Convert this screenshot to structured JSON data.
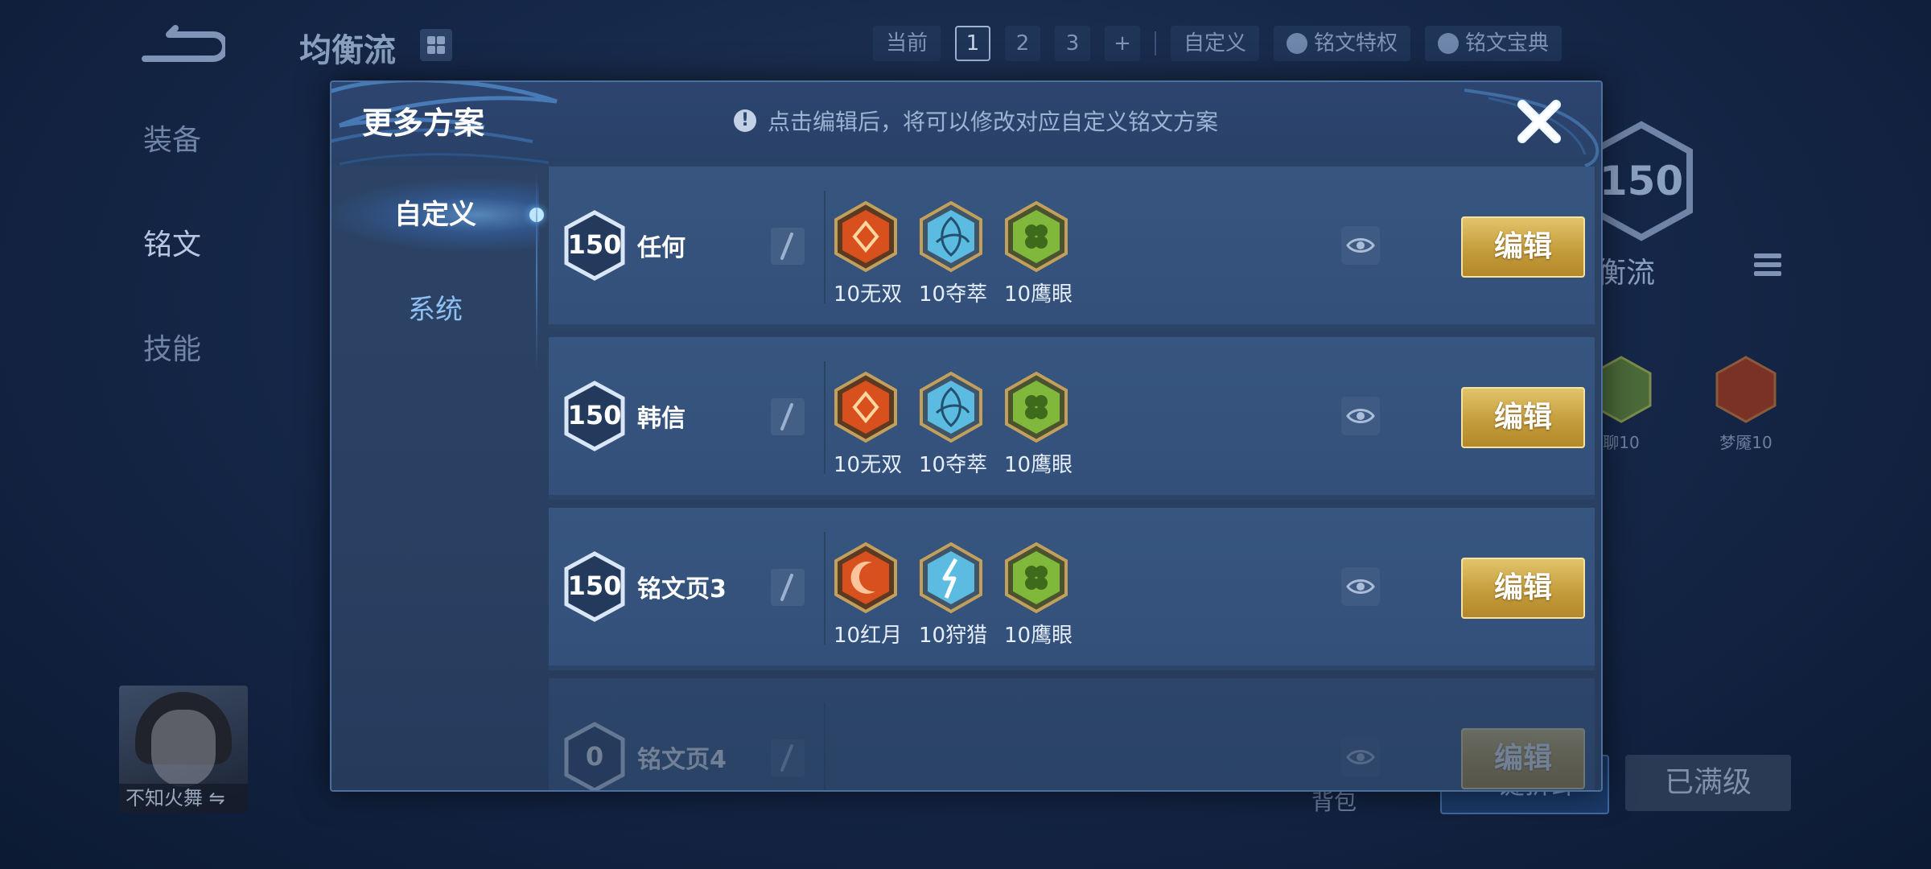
{
  "background": {
    "title": "均衡流",
    "tabs": {
      "current_label": "当前",
      "pages": [
        "1",
        "2",
        "3"
      ],
      "add": "+",
      "custom": "自定义",
      "feature": "铭文特权",
      "codex": "铭文宝典"
    },
    "left_nav": [
      "装备",
      "铭文",
      "技能"
    ],
    "right_panel": {
      "level": "150",
      "name": "衡流",
      "items": [
        {
          "label": "聊10"
        },
        {
          "label": "梦魇10"
        }
      ]
    },
    "avatar_name": "不知火舞 ⇋",
    "bag_label": "背包",
    "equip_button": "一键拆卸",
    "full_button": "已满级"
  },
  "modal": {
    "title": "更多方案",
    "hint": "点击编辑后，将可以修改对应自定义铭文方案",
    "side_tabs": [
      "自定义",
      "系统"
    ],
    "rows": [
      {
        "level": "150",
        "name": "任何",
        "runes": [
          {
            "label": "10无双",
            "color": "#d8501e",
            "icon": "red-rune-icon"
          },
          {
            "label": "10夺萃",
            "color": "#5bbbe0",
            "icon": "blue-rune-icon"
          },
          {
            "label": "10鹰眼",
            "color": "#7fb83a",
            "icon": "green-rune-icon"
          }
        ],
        "edit": "编辑"
      },
      {
        "level": "150",
        "name": "韩信",
        "runes": [
          {
            "label": "10无双",
            "color": "#d8501e",
            "icon": "red-rune-icon"
          },
          {
            "label": "10夺萃",
            "color": "#5bbbe0",
            "icon": "blue-rune-icon"
          },
          {
            "label": "10鹰眼",
            "color": "#7fb83a",
            "icon": "green-rune-icon"
          }
        ],
        "edit": "编辑"
      },
      {
        "level": "150",
        "name": "铭文页3",
        "runes": [
          {
            "label": "10红月",
            "color": "#d8501e",
            "icon": "red-moon-rune-icon"
          },
          {
            "label": "10狩猎",
            "color": "#5bbbe0",
            "icon": "blue-hunt-rune-icon"
          },
          {
            "label": "10鹰眼",
            "color": "#7fb83a",
            "icon": "green-rune-icon"
          }
        ],
        "edit": "编辑"
      },
      {
        "level": "0",
        "name": "铭文页4",
        "runes": [],
        "edit": "编辑"
      }
    ]
  },
  "colors": {
    "accent_gold": "#d4b256",
    "panel": "#2d4466",
    "row": "#36557f"
  }
}
